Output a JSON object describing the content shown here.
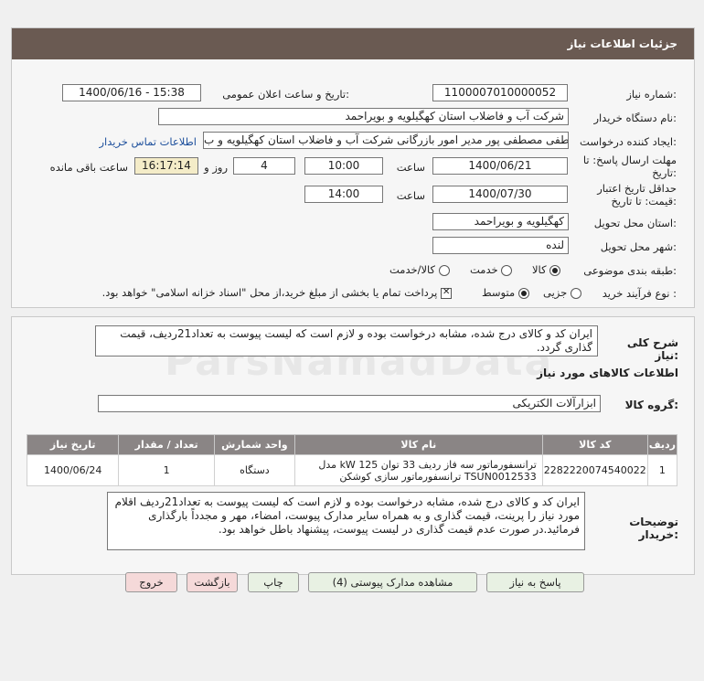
{
  "header": {
    "title": "جزئیات اطلاعات نیاز"
  },
  "form": {
    "need_number_label": "شماره نیاز:",
    "need_number": "1100007010000052",
    "announce_label": "تاریخ و ساعت اعلان عمومی:",
    "announce_value": "1400/06/16 - 15:38",
    "buyer_label": "نام دستگاه خریدار:",
    "buyer_value": "شرکت آب و فاضلاب استان کهگیلویه و بویراحمد",
    "creator_label": "ایجاد کننده درخواست:",
    "creator_value": "مصطفی مصطفی پور مدیر امور بازرگانی شرکت آب و فاضلاب استان کهگیلویه و ب",
    "contact_link": "اطلاعات تماس خریدار",
    "deadline_label": "مهلت ارسال پاسخ: تا تاریخ:",
    "deadline_date": "1400/06/21",
    "time_label": "ساعت",
    "deadline_time": "10:00",
    "days_value": "4",
    "days_label": "روز و",
    "remaining_time": "16:17:14",
    "remaining_label": "ساعت باقی مانده",
    "validity_label": "حداقل تاریخ اعتبار قیمت: تا تاریخ:",
    "validity_date": "1400/07/30",
    "validity_time": "14:00",
    "province_label": "استان محل تحویل:",
    "province_value": "کهگیلویه و بویراحمد",
    "city_label": "شهر محل تحویل:",
    "city_value": "لنده",
    "category_label": "طبقه بندی موضوعی:",
    "category_options": [
      "کالا",
      "خدمت",
      "کالا/خدمت"
    ],
    "process_label": "نوع فرآیند خرید :",
    "process_options": [
      "جزیی",
      "متوسط"
    ],
    "payment_note": "پرداخت تمام یا بخشی از مبلغ خرید،از محل \"اسناد خزانه اسلامی\" خواهد بود."
  },
  "description": {
    "label": "شرح کلی نیاز:",
    "text": "ایران کد و کالای درج شده، مشابه درخواست بوده و لازم است که لیست پیوست به تعداد21ردیف، قیمت گذاری گردد."
  },
  "goods_section_title": "اطلاعات کالاهای مورد نیاز",
  "goods_group_label": "گروه کالا:",
  "goods_group_value": "ابزارآلات الکتریکی",
  "table": {
    "headers": [
      "ردیف",
      "کد کالا",
      "نام کالا",
      "واحد شمارش",
      "تعداد / مقدار",
      "تاریخ نیاز"
    ],
    "rows": [
      {
        "index": "1",
        "code": "2282220074540022",
        "name_line1": "ترانسفورماتور سه فاز ردیف 33 توان 125 kW مدل",
        "name_line2": "TSUN0012533 ترانسفورماتور سازی کوشکن",
        "unit": "دستگاه",
        "qty": "1",
        "date": "1400/06/24"
      }
    ]
  },
  "buyer_notes": {
    "label": "توضیحات خریدار:",
    "text": "ایران کد و کالای درج شده، مشابه درخواست بوده و لازم است که لیست پیوست به تعداد21ردیف اقلام مورد نیاز را پرینت، قیمت گذاری و به همراه سایر مدارک پیوست، امضاء، مهر و مجدداً بارگذاری فرمائید.در صورت عدم قیمت گذاری در لیست پیوست، پیشنهاد باطل خواهد بود."
  },
  "buttons": {
    "reply": "پاسخ به نیاز",
    "attachments": "مشاهده مدارک پیوستی (4)",
    "print": "چاپ",
    "back": "بازگشت",
    "exit": "خروج"
  },
  "colors": {
    "title_bar": "#6a5a52",
    "table_header": "#8a8585",
    "time_box": "#f4ecc8"
  }
}
